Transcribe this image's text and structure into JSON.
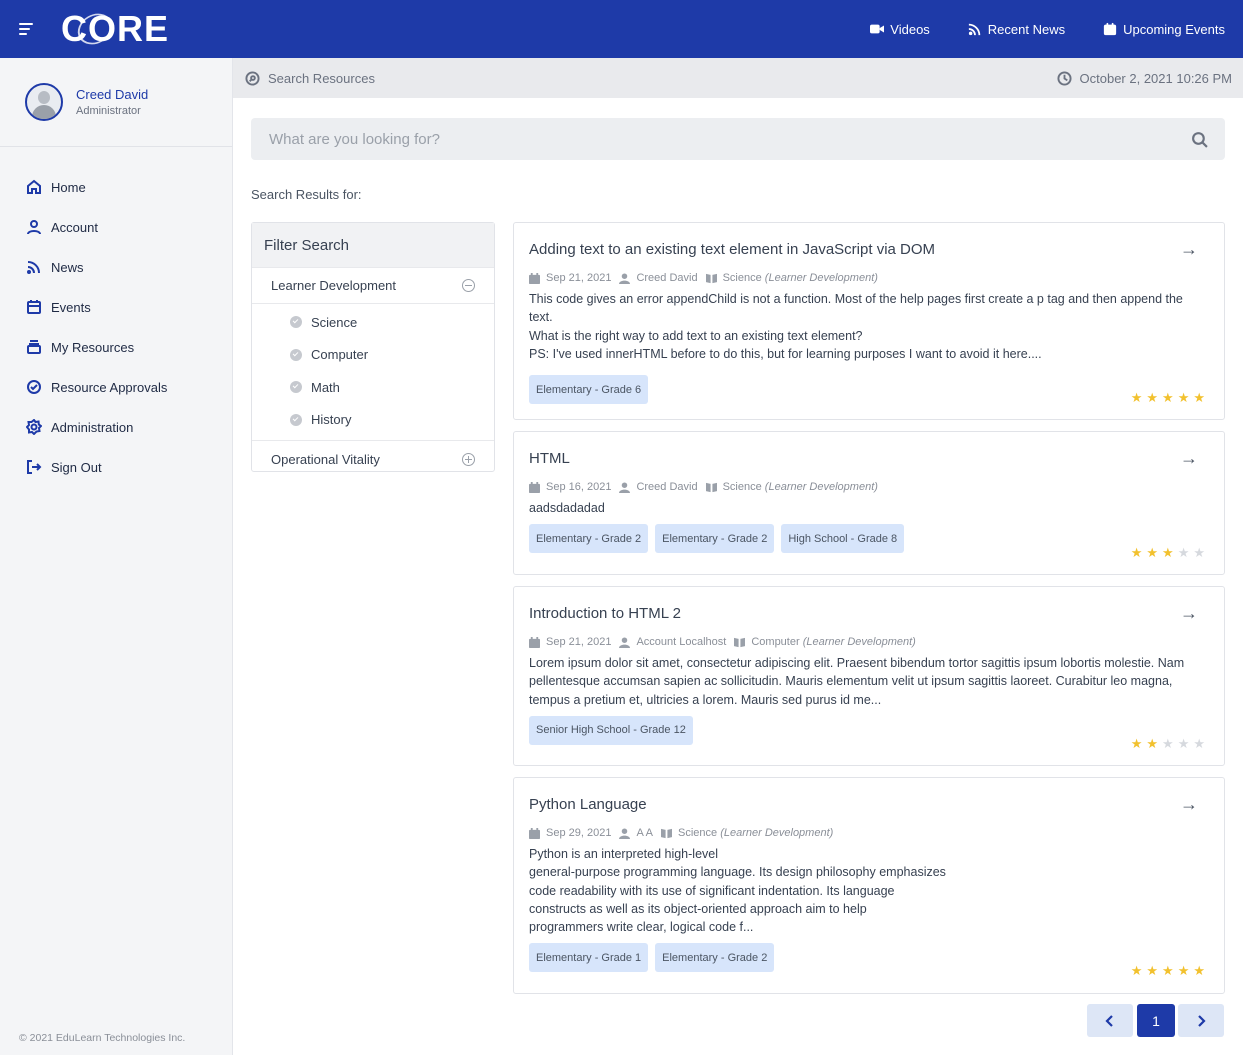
{
  "app": {
    "logo_text": "CORE"
  },
  "topnav": [
    {
      "label": "Videos",
      "icon": "video-icon"
    },
    {
      "label": "Recent News",
      "icon": "rss-icon"
    },
    {
      "label": "Upcoming Events",
      "icon": "calendar-icon"
    }
  ],
  "profile": {
    "name": "Creed David",
    "role": "Administrator"
  },
  "sidebar": {
    "items": [
      {
        "label": "Home",
        "icon": "home-icon"
      },
      {
        "label": "Account",
        "icon": "user-icon"
      },
      {
        "label": "News",
        "icon": "rss-icon"
      },
      {
        "label": "Events",
        "icon": "calendar-icon"
      },
      {
        "label": "My Resources",
        "icon": "stack-icon"
      },
      {
        "label": "Resource Approvals",
        "icon": "check-circle-icon"
      },
      {
        "label": "Administration",
        "icon": "gear-icon"
      },
      {
        "label": "Sign Out",
        "icon": "sign-out-icon"
      }
    ],
    "copyright": "© 2021 EduLearn Technologies Inc."
  },
  "subheader": {
    "title": "Search Resources",
    "datetime": "October 2, 2021 10:26 PM"
  },
  "search": {
    "placeholder": "What are you looking for?",
    "value": ""
  },
  "results_label": "Search Results for:",
  "filter": {
    "title": "Filter Search",
    "categories": [
      {
        "label": "Learner Development",
        "expanded": true,
        "subs": [
          "Science",
          "Computer",
          "Math",
          "History"
        ]
      },
      {
        "label": "Operational Vitality",
        "expanded": false,
        "subs": []
      }
    ]
  },
  "results": [
    {
      "title": "Adding text to an existing text element in JavaScript via DOM",
      "date": "Sep 21, 2021",
      "author": "Creed David",
      "subject": "Science",
      "category": "(Learner Development)",
      "description": "This code gives an error appendChild is not a function. Most of the help pages first create a p tag and then append the text.\nWhat is the right way to add text to an existing text element?\nPS: I've used innerHTML before to do this, but for learning purposes I want to avoid it here....",
      "tags": [
        "Elementary - Grade 6"
      ],
      "rating": 5
    },
    {
      "title": "HTML",
      "date": "Sep 16, 2021",
      "author": "Creed David",
      "subject": "Science",
      "category": "(Learner Development)",
      "description": "aadsdadadad",
      "tags": [
        "Elementary - Grade 2",
        "Elementary - Grade 2",
        "High School - Grade 8"
      ],
      "rating": 3
    },
    {
      "title": "Introduction to HTML 2",
      "date": "Sep 21, 2021",
      "author": "Account Localhost",
      "subject": "Computer",
      "category": "(Learner Development)",
      "description": "Lorem ipsum dolor sit amet, consectetur adipiscing elit. Praesent bibendum tortor sagittis ipsum lobortis molestie. Nam pellentesque accumsan sapien ac sollicitudin. Mauris elementum velit ut ipsum sagittis laoreet. Curabitur leo magna, tempus a pretium et, ultricies a lorem. Mauris sed purus id me...",
      "tags": [
        "Senior High School - Grade 12"
      ],
      "rating": 2
    },
    {
      "title": "Python Language",
      "date": "Sep 29, 2021",
      "author": "A A",
      "subject": "Science",
      "category": "(Learner Development)",
      "description": "Python is an interpreted high-level\ngeneral-purpose programming language. Its design philosophy emphasizes\ncode readability with its use of significant indentation. Its language\nconstructs as well as its object-oriented approach aim to help\nprogrammers write clear, logical code f...",
      "tags": [
        "Elementary - Grade 1",
        "Elementary - Grade 2"
      ],
      "rating": 5
    }
  ],
  "pagination": {
    "current": "1"
  },
  "colors": {
    "brand": "#1e3aa8",
    "star": "#f2c12e",
    "tag_bg": "#d7e5fb"
  }
}
